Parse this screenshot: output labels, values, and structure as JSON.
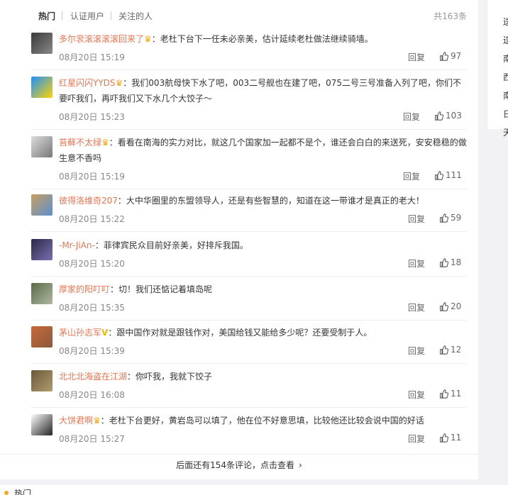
{
  "tabs": [
    "热门",
    "认证用户",
    "关注的人"
  ],
  "total": "共163条",
  "reply_label": "回复",
  "comments": [
    {
      "user": "多尔衮滚滚滚滚回来了",
      "badge": "crown",
      "text": "：老杜下台下一任未必亲美，估计延续老杜做法继续骑墙。",
      "time": "08月20日 15:19",
      "likes": "97"
    },
    {
      "user": "红星闪闪YYDS",
      "badge": "crown",
      "text": "：我们003航母快下水了吧，003二号舰也在建了吧，075二号三号准备入列了吧，你们不要吓我们，再吓我们又下水几个大饺子～",
      "time": "08月20日 15:23",
      "likes": "103"
    },
    {
      "user": "苔藓不太绿",
      "badge": "crown",
      "text": "：看看在南海的实力对比，就这几个国家加一起都不是个，谁还会白白的来送死，安安稳稳的做生意不香吗",
      "time": "08月20日 15:19",
      "likes": "111"
    },
    {
      "user": "彼得洛维奇207",
      "badge": "",
      "text": "：大中华圈里的东盟领导人，还是有些智慧的，知道在这一带谁才是真正的老大！",
      "time": "08月20日 15:22",
      "likes": "59"
    },
    {
      "user": "-Mr-JiAn-",
      "badge": "",
      "text": "：菲律宾民众目前好亲美，好排斥我国。",
      "time": "08月20日 15:20",
      "likes": "18"
    },
    {
      "user": "厚家的阳叮叮",
      "badge": "",
      "text": "：切！我们还惦记着填岛呢",
      "time": "08月20日 15:35",
      "likes": "20"
    },
    {
      "user": "茅山孙志军",
      "badge": "v",
      "text": "：跟中国作对就是跟钱作对，美国给钱又能给多少呢？还要受制于人。",
      "time": "08月20日 15:39",
      "likes": "12"
    },
    {
      "user": "北北北海盗在江湖",
      "badge": "",
      "text": "：你吓我，我就下饺子",
      "time": "08月20日 16:08",
      "likes": "11"
    },
    {
      "user": "大饼君啊",
      "badge": "crown",
      "text": "：老杜下台更好，黄岩岛可以填了，他在位不好意思填，比较他还比较会说中国的好话",
      "time": "08月20日 15:27",
      "likes": "11"
    }
  ],
  "more_text": "后面还有154条评论，点击查看",
  "right_items": [
    "送",
    "送",
    "南",
    "西",
    "南",
    "日",
    "天"
  ],
  "bottom_label": "热门",
  "colors": {
    "username": "#eb7350",
    "crown": "#f5a623",
    "v_badge": "#f2b600"
  }
}
